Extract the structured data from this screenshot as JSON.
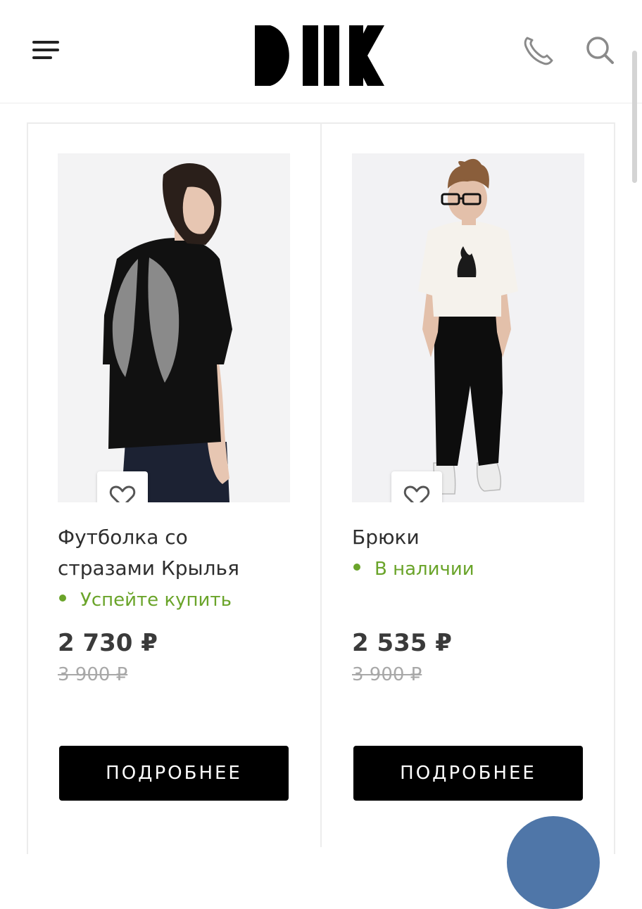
{
  "header": {
    "logo_alt": "DIIK",
    "icons": {
      "menu": "hamburger-icon",
      "phone": "phone-icon",
      "search": "search-icon"
    }
  },
  "products": [
    {
      "title": "Футболка со стразами Крылья",
      "stock": "Успейте купить",
      "price": "2 730 ₽",
      "old_price": "3 900 ₽",
      "button": "ПОДРОБНЕЕ",
      "favorite_icon": "heart-icon"
    },
    {
      "title": "Брюки",
      "stock": "В наличии",
      "price": "2 535 ₽",
      "old_price": "3 900 ₽",
      "button": "ПОДРОБНЕЕ",
      "favorite_icon": "heart-icon"
    }
  ],
  "colors": {
    "accent": "#6aa42a",
    "button_bg": "#000000",
    "chat_bubble": "#4f76a8"
  }
}
